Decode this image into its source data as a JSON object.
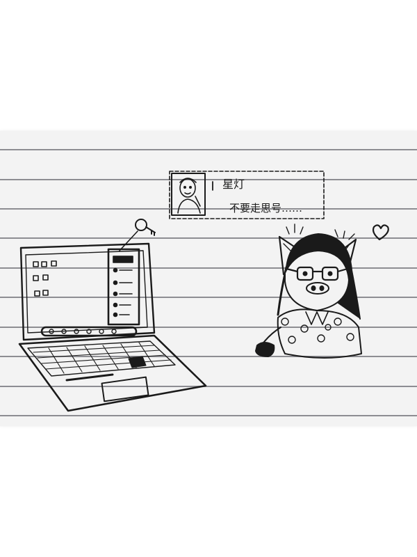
{
  "sketch": {
    "notification": {
      "name": "星灯",
      "message": "不要走思号……"
    }
  },
  "colors": {
    "ink": "#1a1a1a",
    "paper": "#f3f3f3",
    "rule_line": "#8d8d92",
    "page_margin": "#ffffff"
  }
}
